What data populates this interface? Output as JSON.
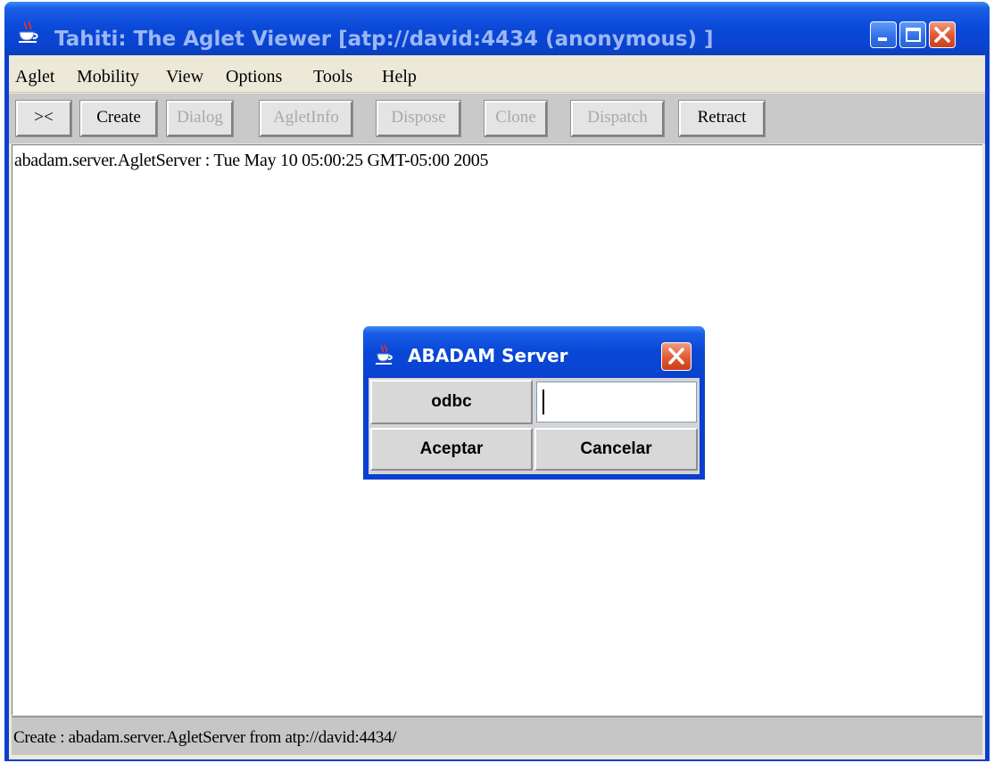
{
  "window": {
    "title": "Tahiti: The Aglet Viewer [atp://david:4434 (anonymous) ]"
  },
  "menubar": {
    "items": [
      "Aglet",
      "Mobility",
      "View",
      "Options",
      "Tools",
      "Help"
    ]
  },
  "toolbar": {
    "buttons": [
      {
        "label": "><",
        "enabled": true
      },
      {
        "label": "Create",
        "enabled": true
      },
      {
        "label": "Dialog",
        "enabled": false
      },
      {
        "label": "AgletInfo",
        "enabled": false
      },
      {
        "label": "Dispose",
        "enabled": false
      },
      {
        "label": "Clone",
        "enabled": false
      },
      {
        "label": "Dispatch",
        "enabled": false
      },
      {
        "label": "Retract",
        "enabled": true
      }
    ]
  },
  "output": {
    "lines": [
      "abadam.server.AgletServer : Tue May 10 05:00:25 GMT-05:00 2005"
    ]
  },
  "statusbar": {
    "text": "Create : abadam.server.AgletServer from atp://david:4434/"
  },
  "dialog": {
    "title": "ABADAM Server",
    "field_label": "odbc",
    "field_value": "",
    "ok_label": "Aceptar",
    "cancel_label": "Cancelar"
  },
  "colors": {
    "titlebar": "#0a48d8",
    "title_text_inactive": "#9bb8f4",
    "client_bg": "#ece9d8",
    "toolbar_bg": "#c9c9c9",
    "close_button": "#e3552e"
  },
  "icons": {
    "app": "java-cup-icon",
    "minimize": "minimize-icon",
    "maximize": "maximize-icon",
    "close": "close-icon"
  }
}
